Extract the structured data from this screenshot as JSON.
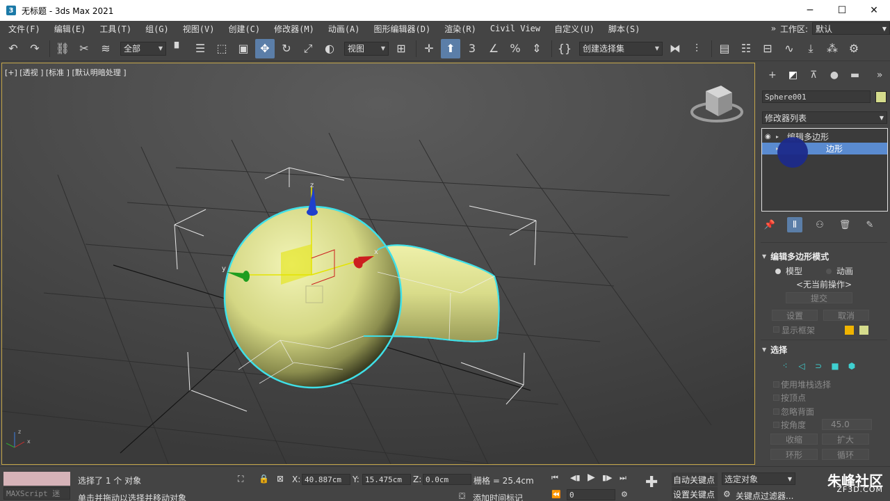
{
  "window": {
    "app_icon": "3",
    "title": "无标题 - 3ds Max 2021",
    "min_icon": "─",
    "max_icon": "☐",
    "close_icon": "✕"
  },
  "menu": {
    "items": [
      "文件(F)",
      "编辑(E)",
      "工具(T)",
      "组(G)",
      "视图(V)",
      "创建(C)",
      "修改器(M)",
      "动画(A)",
      "图形编辑器(D)",
      "渲染(R)",
      "Civil View",
      "自定义(U)",
      "脚本(S)"
    ],
    "more": "»",
    "workspace_label": "工作区:",
    "workspace_value": "默认"
  },
  "toolbar": {
    "filter_value": "全部",
    "refcoord_value": "视图",
    "selset_value": "创建选择集"
  },
  "viewport": {
    "label": "[+] [透视 ] [标准 ] [默认明暗处理 ]",
    "axis_x": "x",
    "axis_y": "y",
    "axis_z": "z",
    "colors": {
      "object": "#d9dd8c",
      "selection_outline": "#3fe0e8",
      "gizmo_x": "#cc1f1f",
      "gizmo_y": "#1f9e1f",
      "gizmo_z": "#1f3fcc"
    }
  },
  "command_panel": {
    "object_name": "Sphere001",
    "object_color": "#d5dc8c",
    "modifier_list": "修改器列表",
    "stack": [
      {
        "label": "编辑多边形",
        "selected": false
      },
      {
        "label": "可编辑多边形",
        "selected": true
      }
    ],
    "selected_stack_visible_label": "边形",
    "rollout_edit_poly_mode": {
      "title": "编辑多边形模式",
      "radio_model": "模型",
      "radio_animate": "动画",
      "no_current_op": "<无当前操作>",
      "commit": "提交",
      "settings": "设置",
      "cancel": "取消",
      "show_cage": "显示框架"
    },
    "rollout_selection": {
      "title": "选择",
      "use_stack_sel": "使用堆栈选择",
      "by_vertex": "按顶点",
      "ignore_backfacing": "忽略背面",
      "by_angle": "按角度",
      "angle_value": "45.0",
      "shrink": "收缩",
      "grow": "扩大",
      "ring": "环形",
      "loop": "循环"
    }
  },
  "status": {
    "maxscript": "MAXScript 迷",
    "selected_text": "选择了 1 个 对象",
    "prompt_text": "单击并拖动以选择并移动对象",
    "x_label": "X:",
    "x_value": "40.887cm",
    "y_label": "Y:",
    "y_value": "15.475cm",
    "z_label": "Z:",
    "z_value": "0.0cm",
    "grid_text": "栅格 = 25.4cm",
    "add_time_tag": "添加时间标记",
    "frame_value": "0",
    "auto_key": "自动关键点",
    "set_key": "设置关键点",
    "selected_obj": "选定对象",
    "key_filters": "关键点过滤器...",
    "watermark": "朱峰社区",
    "watermark_sub": "ZF3D.COM"
  }
}
